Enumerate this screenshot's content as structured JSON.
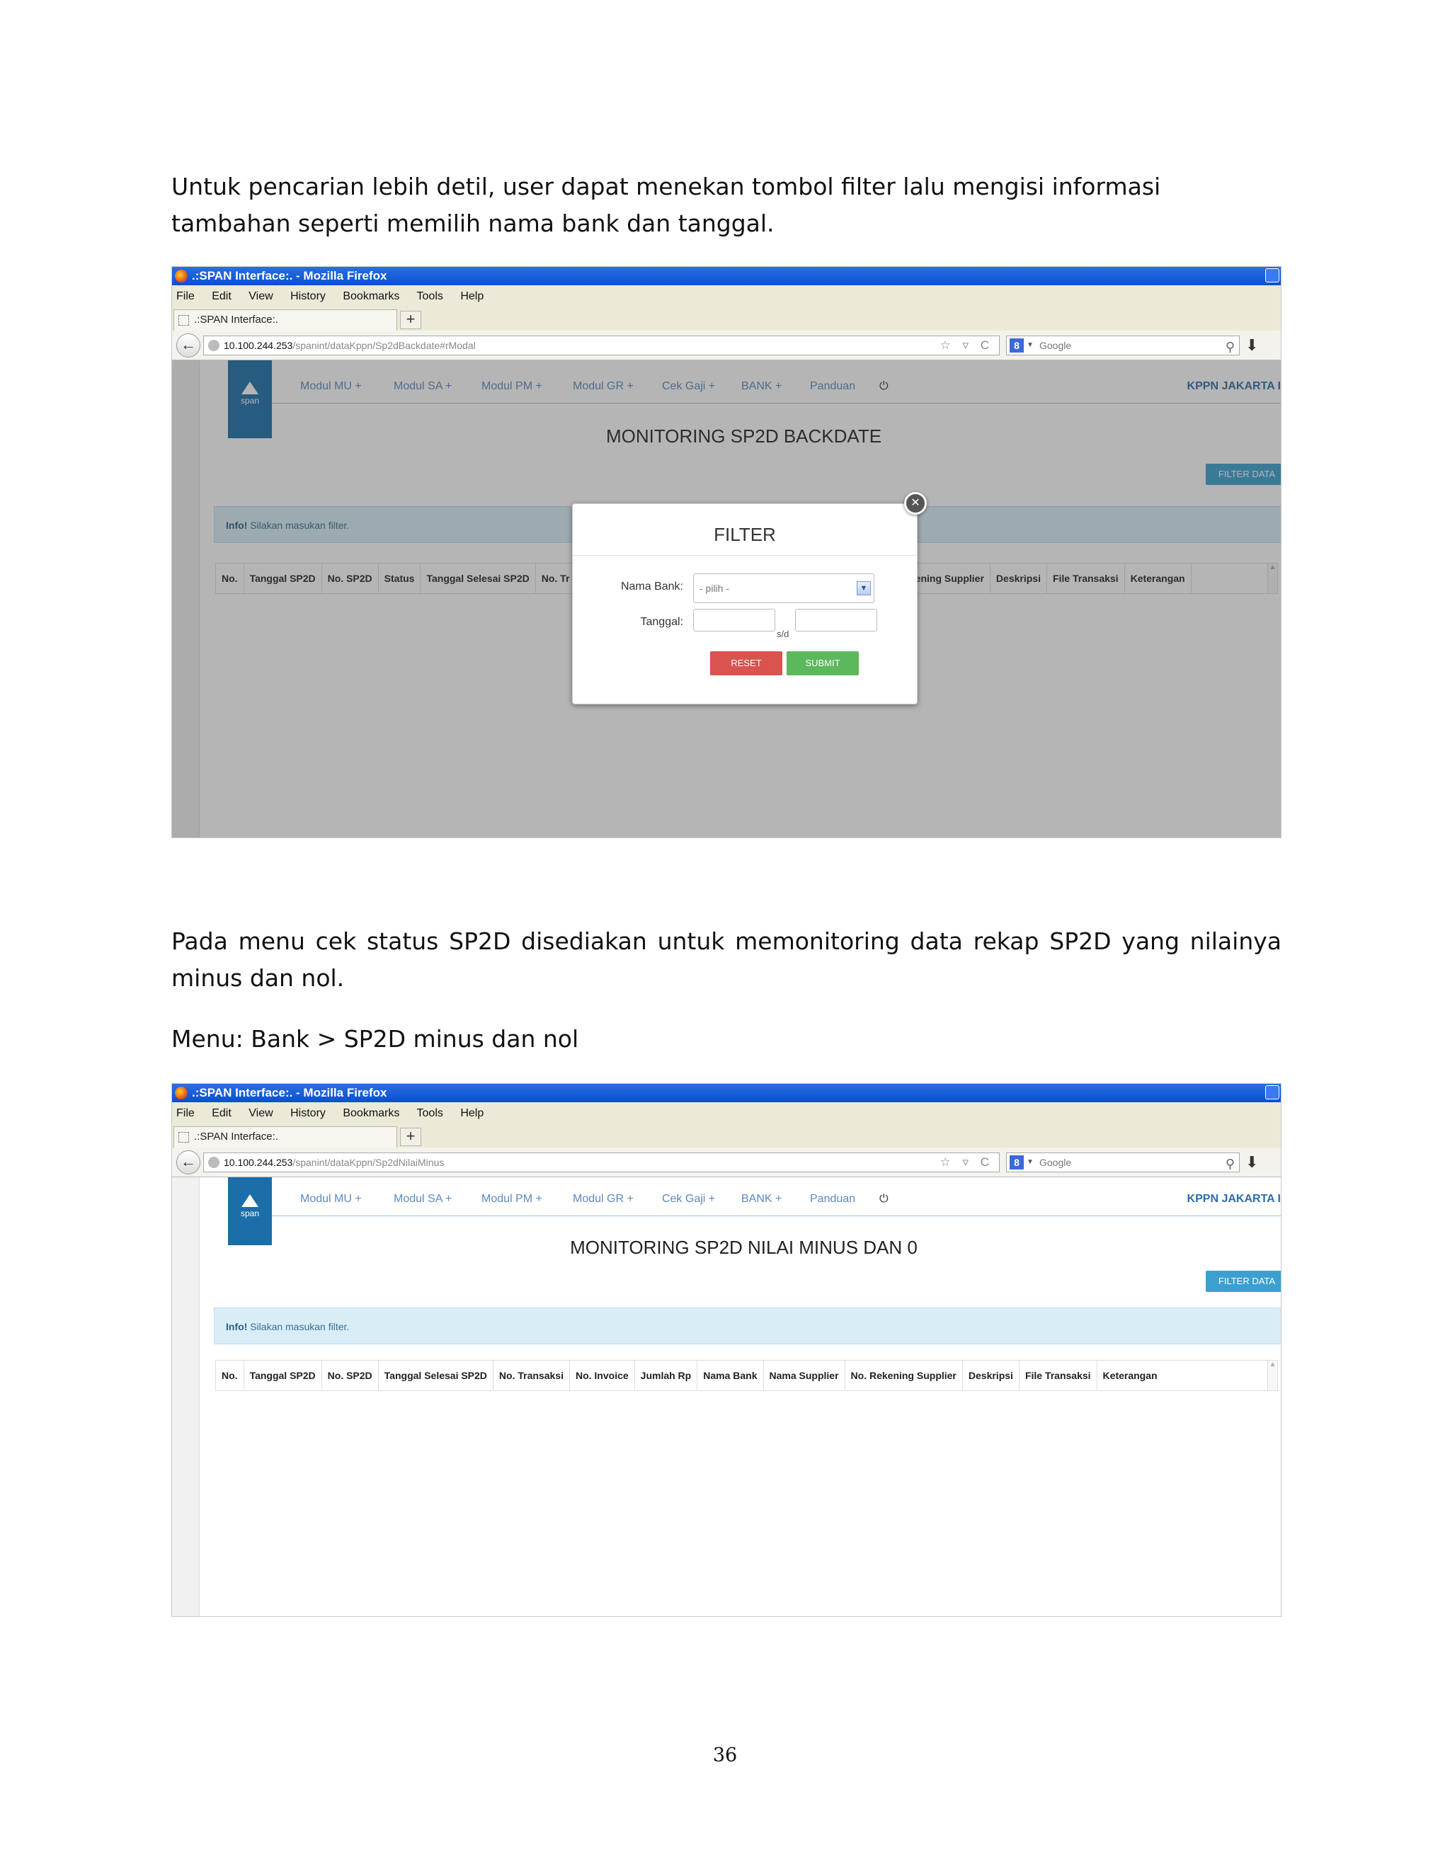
{
  "text": {
    "para1": "Untuk pencarian lebih detil, user dapat menekan tombol filter lalu mengisi informasi tambahan seperti memilih nama bank dan tanggal.",
    "para2": "Pada menu cek status SP2D disediakan untuk memonitoring data rekap SP2D yang nilainya minus dan nol.",
    "para3": "Menu: Bank > SP2D minus dan nol",
    "page_number": "36"
  },
  "browser": {
    "window_title": ".:SPAN Interface:. - Mozilla Firefox",
    "menu": [
      "File",
      "Edit",
      "View",
      "History",
      "Bookmarks",
      "Tools",
      "Help"
    ],
    "tab_title": ".:SPAN Interface:.",
    "new_tab": "+",
    "search_placeholder": "Google",
    "url_icons": "☆ ▿ C"
  },
  "app": {
    "logo_text": "span",
    "nav": [
      "Modul MU +",
      "Modul SA +",
      "Modul PM +",
      "Modul GR +",
      "Cek Gaji +",
      "BANK +",
      "Panduan"
    ],
    "power_icon": "⏻",
    "kppn": "KPPN JAKARTA I",
    "filter_button": "FILTER DATA",
    "info_strong": "Info!",
    "info_text": " Silakan masukan filter."
  },
  "shot1": {
    "url_host": "10.100.244.253",
    "url_path": "/spanint/dataKppn/Sp2dBackdate#rModal",
    "title": "MONITORING SP2D BACKDATE",
    "columns_left": [
      "No.",
      "Tanggal SP2D",
      "No. SP2D",
      "Status",
      "Tanggal Selesai SP2D",
      "No. Tr"
    ],
    "columns_right": [
      "Rekening Supplier",
      "Deskripsi",
      "File Transaksi",
      "Keterangan"
    ],
    "modal": {
      "title": "FILTER",
      "bank_label": "Nama Bank:",
      "bank_value": "- pilih -",
      "date_label": "Tanggal:",
      "sd": "s/d",
      "reset": "RESET",
      "submit": "SUBMIT"
    }
  },
  "shot2": {
    "url_host": "10.100.244.253",
    "url_path": "/spanint/dataKppn/Sp2dNilaiMinus",
    "title": "MONITORING SP2D NILAI MINUS DAN 0",
    "columns": [
      "No.",
      "Tanggal SP2D",
      "No. SP2D",
      "Tanggal Selesai SP2D",
      "No. Transaksi",
      "No. Invoice",
      "Jumlah Rp",
      "Nama Bank",
      "Nama Supplier",
      "No. Rekening Supplier",
      "Deskripsi",
      "File Transaksi",
      "Keterangan"
    ]
  }
}
